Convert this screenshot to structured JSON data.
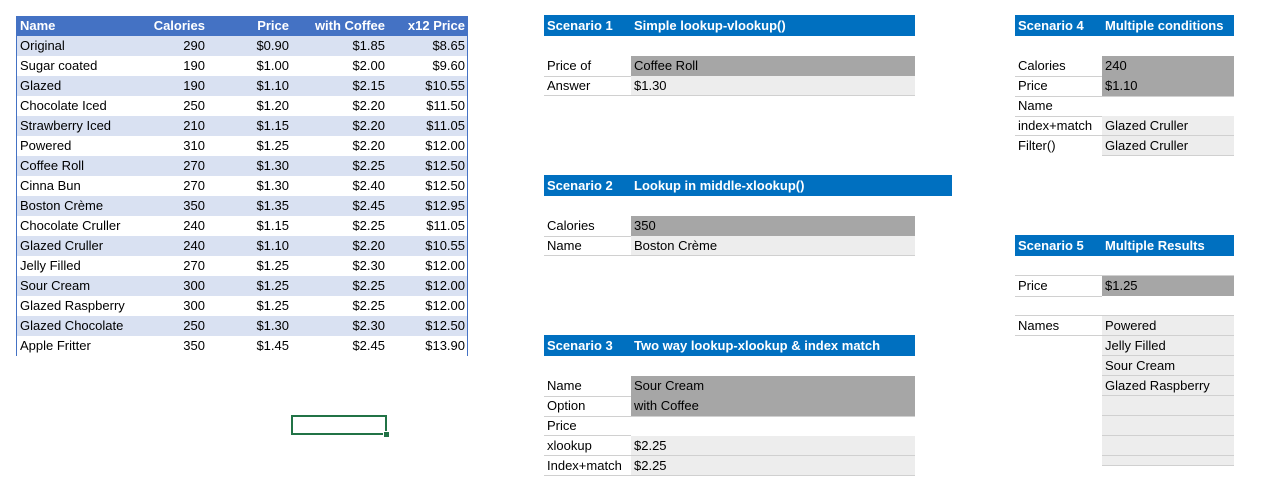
{
  "table": {
    "headers": [
      "Name",
      "Calories",
      "Price",
      "with Coffee",
      "x12 Price"
    ],
    "rows": [
      [
        "Original",
        "290",
        "$0.90",
        "$1.85",
        "$8.65"
      ],
      [
        "Sugar coated",
        "190",
        "$1.00",
        "$2.00",
        "$9.60"
      ],
      [
        "Glazed",
        "190",
        "$1.10",
        "$2.15",
        "$10.55"
      ],
      [
        "Chocolate Iced",
        "250",
        "$1.20",
        "$2.20",
        "$11.50"
      ],
      [
        "Strawberry Iced",
        "210",
        "$1.15",
        "$2.20",
        "$11.05"
      ],
      [
        "Powered",
        "310",
        "$1.25",
        "$2.20",
        "$12.00"
      ],
      [
        "Coffee Roll",
        "270",
        "$1.30",
        "$2.25",
        "$12.50"
      ],
      [
        "Cinna Bun",
        "270",
        "$1.30",
        "$2.40",
        "$12.50"
      ],
      [
        "Boston Crème",
        "350",
        "$1.35",
        "$2.45",
        "$12.95"
      ],
      [
        "Chocolate Cruller",
        "240",
        "$1.15",
        "$2.25",
        "$11.05"
      ],
      [
        "Glazed Cruller",
        "240",
        "$1.10",
        "$2.20",
        "$10.55"
      ],
      [
        "Jelly Filled",
        "270",
        "$1.25",
        "$2.30",
        "$12.00"
      ],
      [
        "Sour Cream",
        "300",
        "$1.25",
        "$2.25",
        "$12.00"
      ],
      [
        "Glazed Raspberry",
        "300",
        "$1.25",
        "$2.25",
        "$12.00"
      ],
      [
        "Glazed Chocolate",
        "250",
        "$1.30",
        "$2.30",
        "$12.50"
      ],
      [
        "Apple Fritter",
        "350",
        "$1.45",
        "$2.45",
        "$13.90"
      ]
    ]
  },
  "scenario1": {
    "label": "Scenario 1",
    "title": "Simple lookup-vlookup()",
    "price_of_label": "Price of",
    "price_of_value": "Coffee Roll",
    "answer_label": "Answer",
    "answer_value": "$1.30"
  },
  "scenario2": {
    "label": "Scenario 2",
    "title": "Lookup in middle-xlookup()",
    "calories_label": "Calories",
    "calories_value": "350",
    "name_label": "Name",
    "name_value": "Boston Crème"
  },
  "scenario3": {
    "label": "Scenario 3",
    "title": "Two way lookup-xlookup & index match",
    "name_label": "Name",
    "name_value": "Sour Cream",
    "option_label": "Option",
    "option_value": "with Coffee",
    "price_label": "Price",
    "xlookup_label": "xlookup",
    "xlookup_value": "$2.25",
    "indexmatch_label": "Index+match",
    "indexmatch_value": "$2.25"
  },
  "scenario4": {
    "label": "Scenario 4",
    "title": "Multiple conditions",
    "calories_label": "Calories",
    "calories_value": "240",
    "price_label": "Price",
    "price_value": "$1.10",
    "name_label": "Name",
    "indexmatch_label": "index+match",
    "indexmatch_value": "Glazed Cruller",
    "filter_label": "Filter()",
    "filter_value": "Glazed Cruller"
  },
  "scenario5": {
    "label": "Scenario 5",
    "title": "Multiple Results",
    "price_label": "Price",
    "price_value": "$1.25",
    "names_label": "Names",
    "names": [
      "Powered",
      "Jelly Filled",
      "Sour Cream",
      "Glazed Raspberry"
    ]
  }
}
